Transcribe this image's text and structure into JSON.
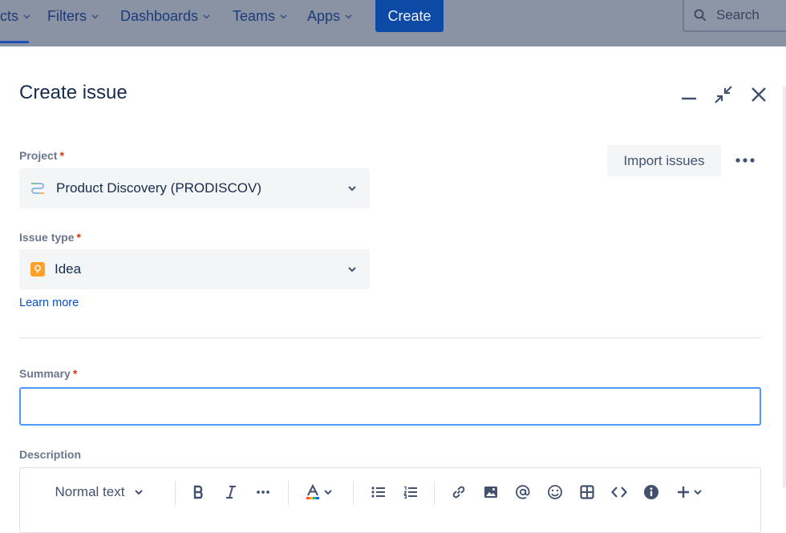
{
  "nav": {
    "items": [
      {
        "label": "cts"
      },
      {
        "label": "Filters"
      },
      {
        "label": "Dashboards"
      },
      {
        "label": "Teams"
      },
      {
        "label": "Apps"
      }
    ],
    "create_label": "Create",
    "search_placeholder": "Search"
  },
  "modal": {
    "title": "Create issue",
    "header_icons": [
      "minimize-icon",
      "collapse-icon",
      "close-icon"
    ],
    "import_label": "Import issues",
    "project": {
      "label": "Project",
      "required_mark": "*",
      "value": "Product Discovery (PRODISCOV)"
    },
    "issue_type": {
      "label": "Issue type",
      "required_mark": "*",
      "value": "Idea",
      "icon_color": "#FFA128"
    },
    "learn_more": "Learn more",
    "summary": {
      "label": "Summary",
      "required_mark": "*",
      "value": ""
    },
    "description": {
      "label": "Description",
      "text_style": "Normal text"
    }
  },
  "colors": {
    "accent": "#0052CC",
    "required": "#DE350B",
    "focus_border": "#4C9AFF"
  }
}
